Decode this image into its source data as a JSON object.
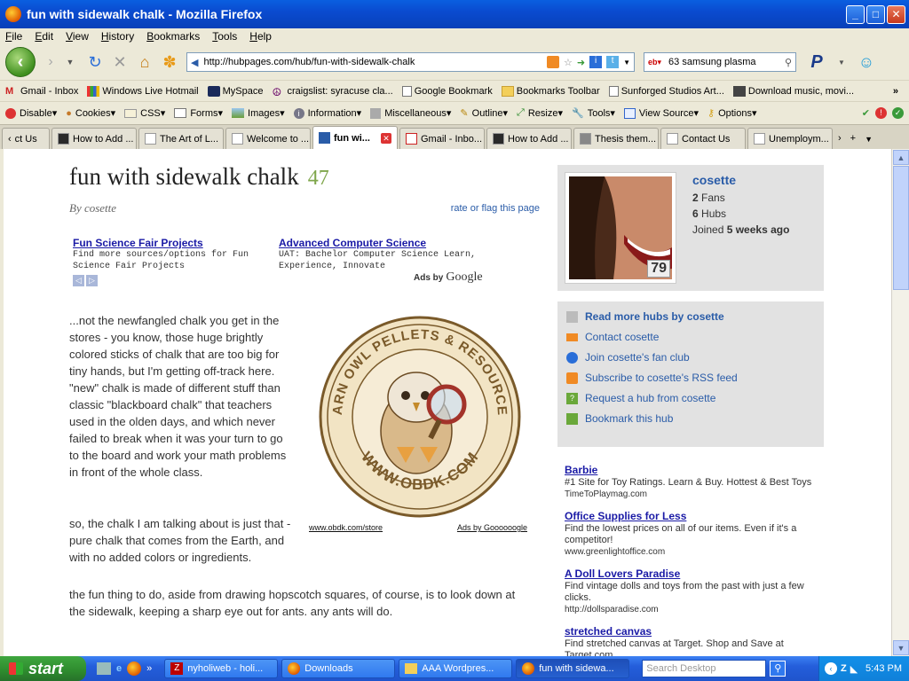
{
  "window": {
    "title": "fun with sidewalk chalk - Mozilla Firefox"
  },
  "menu": [
    "File",
    "Edit",
    "View",
    "History",
    "Bookmarks",
    "Tools",
    "Help"
  ],
  "nav": {
    "url": "http://hubpages.com/hub/fun-with-sidewalk-chalk",
    "search_value": "63 samsung plasma"
  },
  "bookmarks": [
    "Gmail - Inbox",
    "Windows Live Hotmail",
    "MySpace",
    "craigslist: syracuse cla...",
    "Google Bookmark",
    "Bookmarks Toolbar",
    "Sunforged Studios Art...",
    "Download music, movi..."
  ],
  "devbar": [
    "Disable",
    "Cookies",
    "CSS",
    "Forms",
    "Images",
    "Information",
    "Miscellaneous",
    "Outline",
    "Resize",
    "Tools",
    "View Source",
    "Options"
  ],
  "tabs": [
    "ct Us",
    "How to Add ...",
    "The Art of L...",
    "Welcome to ...",
    "fun wi...",
    "Gmail - Inbo...",
    "How to Add ...",
    "Thesis them...",
    "Contact Us",
    "Unemploym..."
  ],
  "article": {
    "title": "fun with sidewalk chalk",
    "score": "47",
    "byline": "By cosette",
    "rate_link": "rate or flag this page",
    "paragraphs": [
      "...not the newfangled chalk you get in the stores - you know, those huge brightly colored sticks of chalk that are too big for tiny hands, but I'm getting off-track here. \"new\" chalk is made of different stuff than classic \"blackboard chalk\" that teachers used in the olden days, and which never failed to break when it was your turn to go to the board and work your math problems in front of the whole class.",
      "so, the chalk I am talking about is just that - pure chalk that comes from the Earth, and with no added colors or ingredients.",
      "the fun thing to do, aside from drawing hopscotch squares, of course, is to look down at the sidewalk, keeping a sharp eye out for ants. any ants will do."
    ]
  },
  "google_ads": {
    "ad1_title": "Fun Science Fair Projects",
    "ad1_text": "Find more sources/options for Fun Science Fair Projects",
    "ad2_title": "Advanced Computer Science",
    "ad2_text": "UAT: Bachelor Computer Science Learn, Experience, Innovate",
    "ads_by": "Ads by",
    "google": "Google"
  },
  "image": {
    "logo_top": "BARN OWL PELLETS & RESOURCES",
    "logo_bottom": "WWW.OBDK.COM",
    "caption_link": "www.obdk.com/store",
    "ads_link": "Ads by Goooooogle"
  },
  "author": {
    "name": "cosette",
    "fans_count": "2",
    "fans_label": "Fans",
    "hubs_count": "6",
    "hubs_label": "Hubs",
    "joined_label": "Joined",
    "joined_value": "5 weeks ago",
    "score": "79"
  },
  "sidebar_links": [
    "Read more hubs by cosette",
    "Contact cosette",
    "Join cosette's fan club",
    "Subscribe to cosette's RSS feed",
    "Request a hub from cosette",
    "Bookmark this hub"
  ],
  "side_ads": [
    {
      "title": "Barbie",
      "text": "#1 Site for Toy Ratings. Learn & Buy. Hottest & Best Toys",
      "url": "TimeToPlaymag.com"
    },
    {
      "title": "Office Supplies for Less",
      "text": "Find the lowest prices on all of our items. Even if it's a competitor!",
      "url": "www.greenlightoffice.com"
    },
    {
      "title": "A Doll Lovers Paradise",
      "text": "Find vintage dolls and toys from the past with just a few clicks.",
      "url": "http://dollsparadise.com"
    },
    {
      "title": "stretched canvas",
      "text": "Find stretched canvas at Target. Shop and Save at Target.com.",
      "url": ""
    }
  ],
  "taskbar": {
    "start": "start",
    "buttons": [
      "nyholiweb - holi...",
      "Downloads",
      "AAA Wordpres...",
      "fun with sidewa..."
    ],
    "search_placeholder": "Search Desktop",
    "clock": "5:43 PM"
  },
  "colors": {
    "accent": "#2a5ca8",
    "sidebar_bg": "#e2e2e2",
    "score_green": "#7fa64b"
  }
}
